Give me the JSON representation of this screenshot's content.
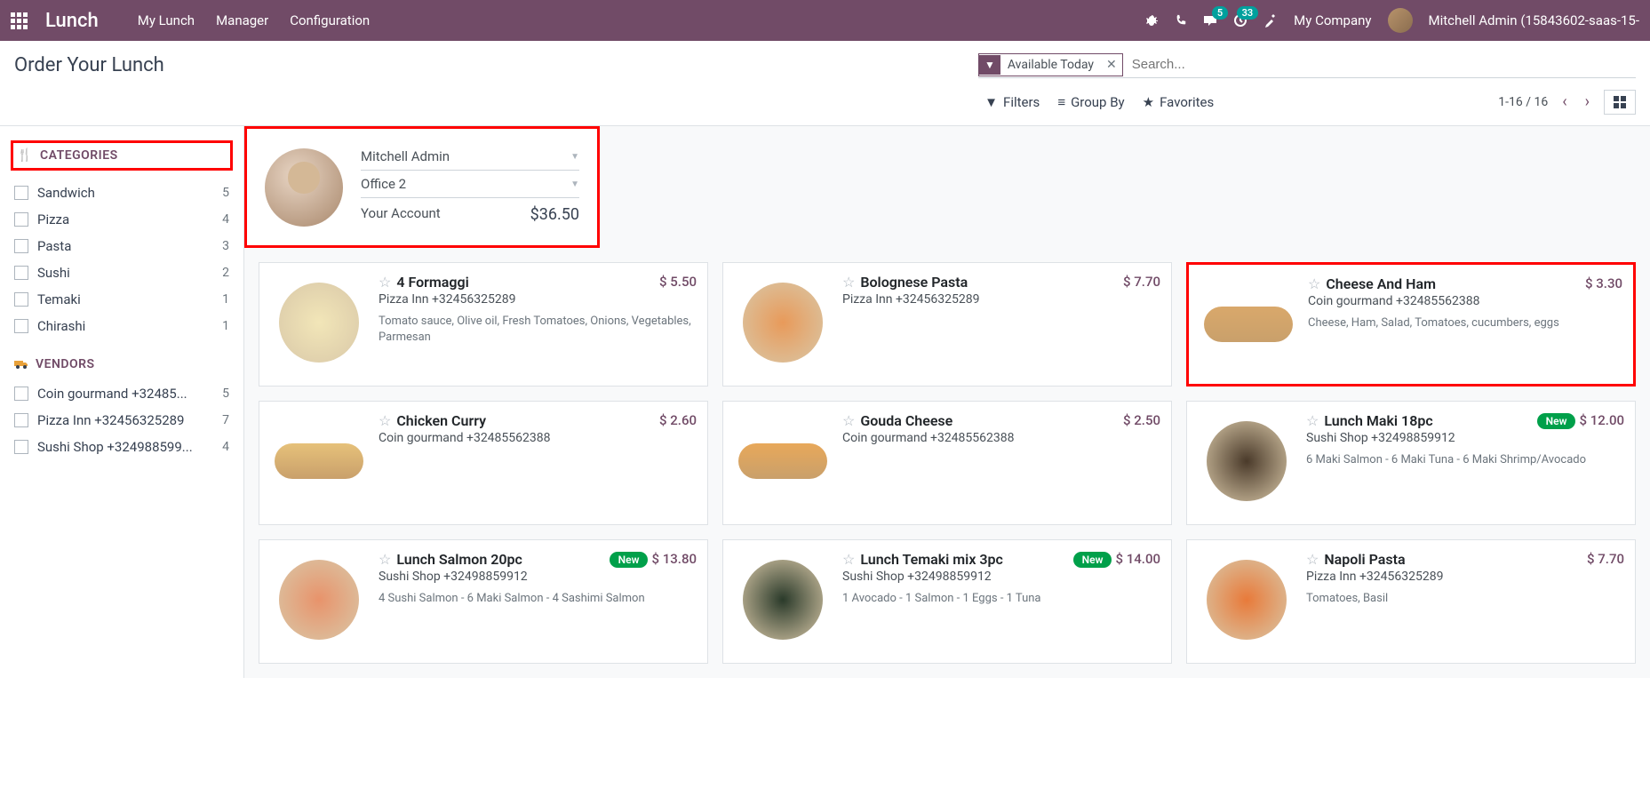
{
  "nav": {
    "brand": "Lunch",
    "menu": [
      "My Lunch",
      "Manager",
      "Configuration"
    ],
    "company": "My Company",
    "user": "Mitchell Admin (15843602-saas-15-",
    "msg_badge": "5",
    "activity_badge": "33"
  },
  "control": {
    "title": "Order Your Lunch",
    "facet": "Available Today",
    "search_placeholder": "Search...",
    "filters": "Filters",
    "groupby": "Group By",
    "favorites": "Favorites",
    "pager": "1-16 / 16"
  },
  "sidebar": {
    "categories_label": "CATEGORIES",
    "vendors_label": "VENDORS",
    "categories": [
      {
        "name": "Sandwich",
        "count": "5"
      },
      {
        "name": "Pizza",
        "count": "4"
      },
      {
        "name": "Pasta",
        "count": "3"
      },
      {
        "name": "Sushi",
        "count": "2"
      },
      {
        "name": "Temaki",
        "count": "1"
      },
      {
        "name": "Chirashi",
        "count": "1"
      }
    ],
    "vendors": [
      {
        "name": "Coin gourmand +32485...",
        "count": "5"
      },
      {
        "name": "Pizza Inn +32456325289",
        "count": "7"
      },
      {
        "name": "Sushi Shop +324988599...",
        "count": "4"
      }
    ]
  },
  "user_panel": {
    "name": "Mitchell Admin",
    "location": "Office 2",
    "account_label": "Your Account",
    "balance": "$36.50"
  },
  "products": [
    {
      "name": "4 Formaggi",
      "price": "$ 5.50",
      "vendor": "Pizza Inn +32456325289",
      "desc": "Tomato sauce, Olive oil, Fresh Tomatoes, Onions, Vegetables, Parmesan",
      "new": false,
      "highlighted": false,
      "color": "#f2e6b8",
      "shape": "circle"
    },
    {
      "name": "Bolognese Pasta",
      "price": "$ 7.70",
      "vendor": "Pizza Inn +32456325289",
      "desc": "",
      "new": false,
      "highlighted": false,
      "color": "#e89a5a",
      "shape": "circle"
    },
    {
      "name": "Cheese And Ham",
      "price": "$ 3.30",
      "vendor": "Coin gourmand +32485562388",
      "desc": "Cheese, Ham, Salad, Tomatoes, cucumbers, eggs",
      "new": false,
      "highlighted": true,
      "color": "#d9a86b",
      "shape": "sandwich"
    },
    {
      "name": "Chicken Curry",
      "price": "$ 2.60",
      "vendor": "Coin gourmand +32485562388",
      "desc": "",
      "new": false,
      "highlighted": false,
      "color": "#e6c17a",
      "shape": "sandwich"
    },
    {
      "name": "Gouda Cheese",
      "price": "$ 2.50",
      "vendor": "Coin gourmand +32485562388",
      "desc": "",
      "new": false,
      "highlighted": false,
      "color": "#e8a85a",
      "shape": "sandwich"
    },
    {
      "name": "Lunch Maki 18pc",
      "price": "$ 12.00",
      "vendor": "Sushi Shop +32498859912",
      "desc": "6 Maki Salmon - 6 Maki Tuna - 6 Maki Shrimp/Avocado",
      "new": true,
      "highlighted": false,
      "color": "#4a3a2a",
      "shape": "circle"
    },
    {
      "name": "Lunch Salmon 20pc",
      "price": "$ 13.80",
      "vendor": "Sushi Shop +32498859912",
      "desc": "4 Sushi Salmon - 6 Maki Salmon - 4 Sashimi Salmon",
      "new": true,
      "highlighted": false,
      "color": "#e8936b",
      "shape": "circle"
    },
    {
      "name": "Lunch Temaki mix 3pc",
      "price": "$ 14.00",
      "vendor": "Sushi Shop +32498859912",
      "desc": "1 Avocado - 1 Salmon - 1 Eggs - 1 Tuna",
      "new": true,
      "highlighted": false,
      "color": "#2a3a2a",
      "shape": "circle"
    },
    {
      "name": "Napoli Pasta",
      "price": "$ 7.70",
      "vendor": "Pizza Inn +32456325289",
      "desc": "Tomatoes, Basil",
      "new": false,
      "highlighted": false,
      "color": "#e87a3a",
      "shape": "circle"
    }
  ]
}
